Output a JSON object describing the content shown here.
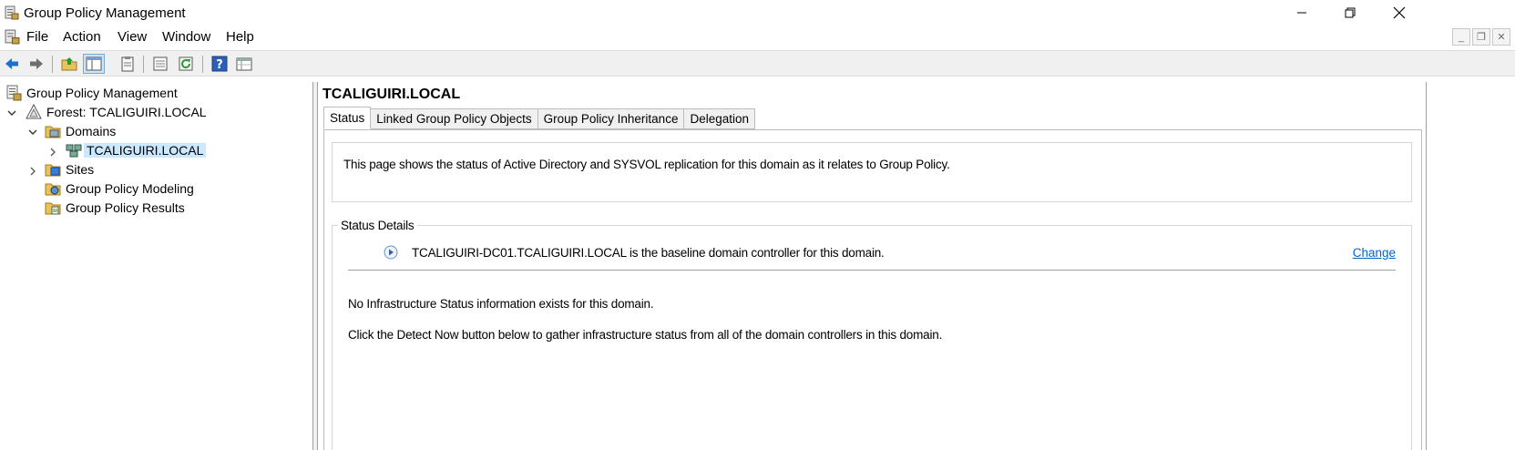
{
  "window": {
    "title": "Group Policy Management"
  },
  "menu": {
    "items": [
      "File",
      "Action",
      "View",
      "Window",
      "Help"
    ]
  },
  "toolbar": {
    "icons": [
      "back-arrow-icon",
      "forward-arrow-icon",
      "up-folder-icon",
      "show-hide-console-tree-icon",
      "clipboard-icon",
      "properties-icon",
      "refresh-icon",
      "help-icon",
      "export-list-icon"
    ]
  },
  "tree": {
    "root": "Group Policy Management",
    "forest": "Forest: TCALIGUIRI.LOCAL",
    "domains": "Domains",
    "domain": "TCALIGUIRI.LOCAL",
    "sites": "Sites",
    "modeling": "Group Policy Modeling",
    "results": "Group Policy Results"
  },
  "main": {
    "title": "TCALIGUIRI.LOCAL",
    "tabs": [
      "Status",
      "Linked Group Policy Objects",
      "Group Policy Inheritance",
      "Delegation"
    ],
    "active_tab": "Status",
    "info_text": "This page shows the status of Active Directory and SYSVOL replication for this domain as it relates to Group Policy.",
    "details": {
      "legend": "Status Details",
      "baseline_text": "TCALIGUIRI-DC01.TCALIGUIRI.LOCAL is the baseline domain controller for this domain.",
      "change_link": "Change",
      "no_info_text": "No Infrastructure Status information exists for this domain.",
      "detect_text": "Click the Detect Now button below to gather infrastructure status from all of the domain controllers in this domain."
    }
  },
  "colors": {
    "selection": "#cce8ff",
    "link": "#0066cc",
    "toolbar_bg": "#f0f0f0"
  }
}
